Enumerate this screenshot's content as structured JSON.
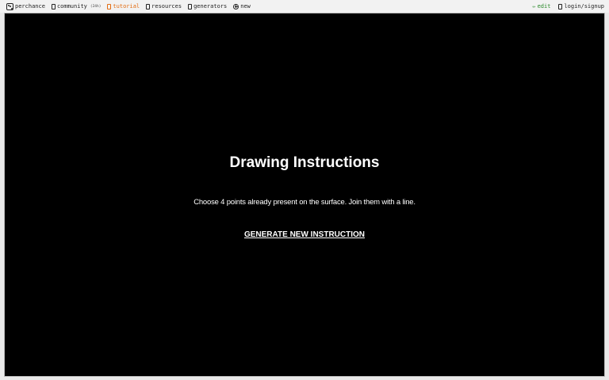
{
  "topbar": {
    "left": [
      {
        "icon": "dice-icon",
        "label": "perchance"
      },
      {
        "icon": "chat-icon",
        "label": "community",
        "badge": "(24h)"
      },
      {
        "icon": "book-icon",
        "label": "tutorial",
        "active": true
      },
      {
        "icon": "book-icon",
        "label": "resources"
      },
      {
        "icon": "grid-icon",
        "label": "generators"
      },
      {
        "icon": "plus-circle-icon",
        "label": "new"
      }
    ],
    "right": [
      {
        "icon": "pencil-icon",
        "label": "edit",
        "glyph": "✏"
      },
      {
        "icon": "user-icon",
        "label": "login/signup"
      }
    ]
  },
  "colors": {
    "accent_tutorial": "#e26b10",
    "accent_edit": "#2a8a2a",
    "canvas_bg": "#000000",
    "text": "#ffffff"
  },
  "main": {
    "title": "Drawing Instructions",
    "instruction": "Choose 4 points already present on the surface. Join them with a line.",
    "generate_label": "GENERATE NEW INSTRUCTION"
  }
}
